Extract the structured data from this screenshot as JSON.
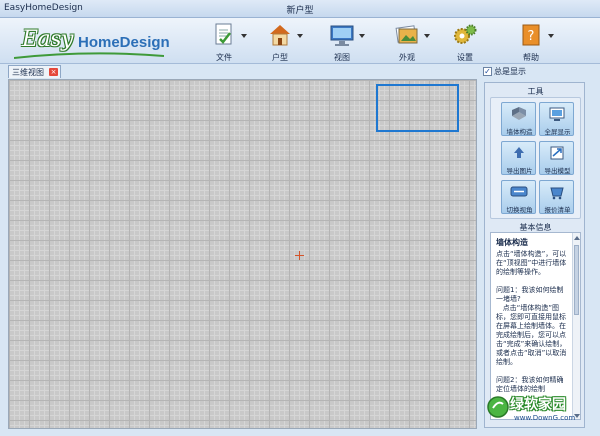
{
  "window": {
    "app_title": "EasyHomeDesign",
    "document_title": "新户型"
  },
  "logo": {
    "easy": "Easy",
    "home_design": "HomeDesign"
  },
  "menu": [
    {
      "label": "文件",
      "icon": "file-icon"
    },
    {
      "label": "户型",
      "icon": "house-icon"
    },
    {
      "label": "视图",
      "icon": "monitor-icon"
    },
    {
      "label": "外观",
      "icon": "picture-icon"
    },
    {
      "label": "设置",
      "icon": "gears-icon"
    },
    {
      "label": "帮助",
      "icon": "help-book-icon"
    }
  ],
  "tabs": {
    "active": "三维视图",
    "close": "×"
  },
  "show_toggle": {
    "label": "总是显示",
    "checked": true,
    "mark": "✓"
  },
  "panel": {
    "tools_title": "工具",
    "tools": [
      {
        "label": "墙体构造",
        "icon": "wall-build-icon"
      },
      {
        "label": "全屏显示",
        "icon": "fullscreen-icon"
      },
      {
        "label": "导出图片",
        "icon": "export-image-icon"
      },
      {
        "label": "导出模型",
        "icon": "export-model-icon"
      },
      {
        "label": "切换视角",
        "icon": "switch-view-icon"
      },
      {
        "label": "报价清单",
        "icon": "quote-list-icon"
      }
    ],
    "info_title": "基本信息",
    "info_heading": "墙体构造",
    "info_body": "点击“墙体构造”，可以在“顶视图”中进行墙体的绘制等操作。\n\n问题1：我该如何绘制一堵墙?\n   点击“墙体构造”图标，您即可直接用鼠标在屏幕上绘制墙体。在完成绘制后，您可以点击“完成”来确认绘制，或者点击“取消”以取消绘制。\n\n问题2：我该如何精确定位墙体的绘制"
  },
  "watermark": {
    "text": "绿软家园",
    "url": "www.DownG.com"
  },
  "colors": {
    "selection_box": "#1f78d1",
    "accent": "#2c6fb7"
  }
}
